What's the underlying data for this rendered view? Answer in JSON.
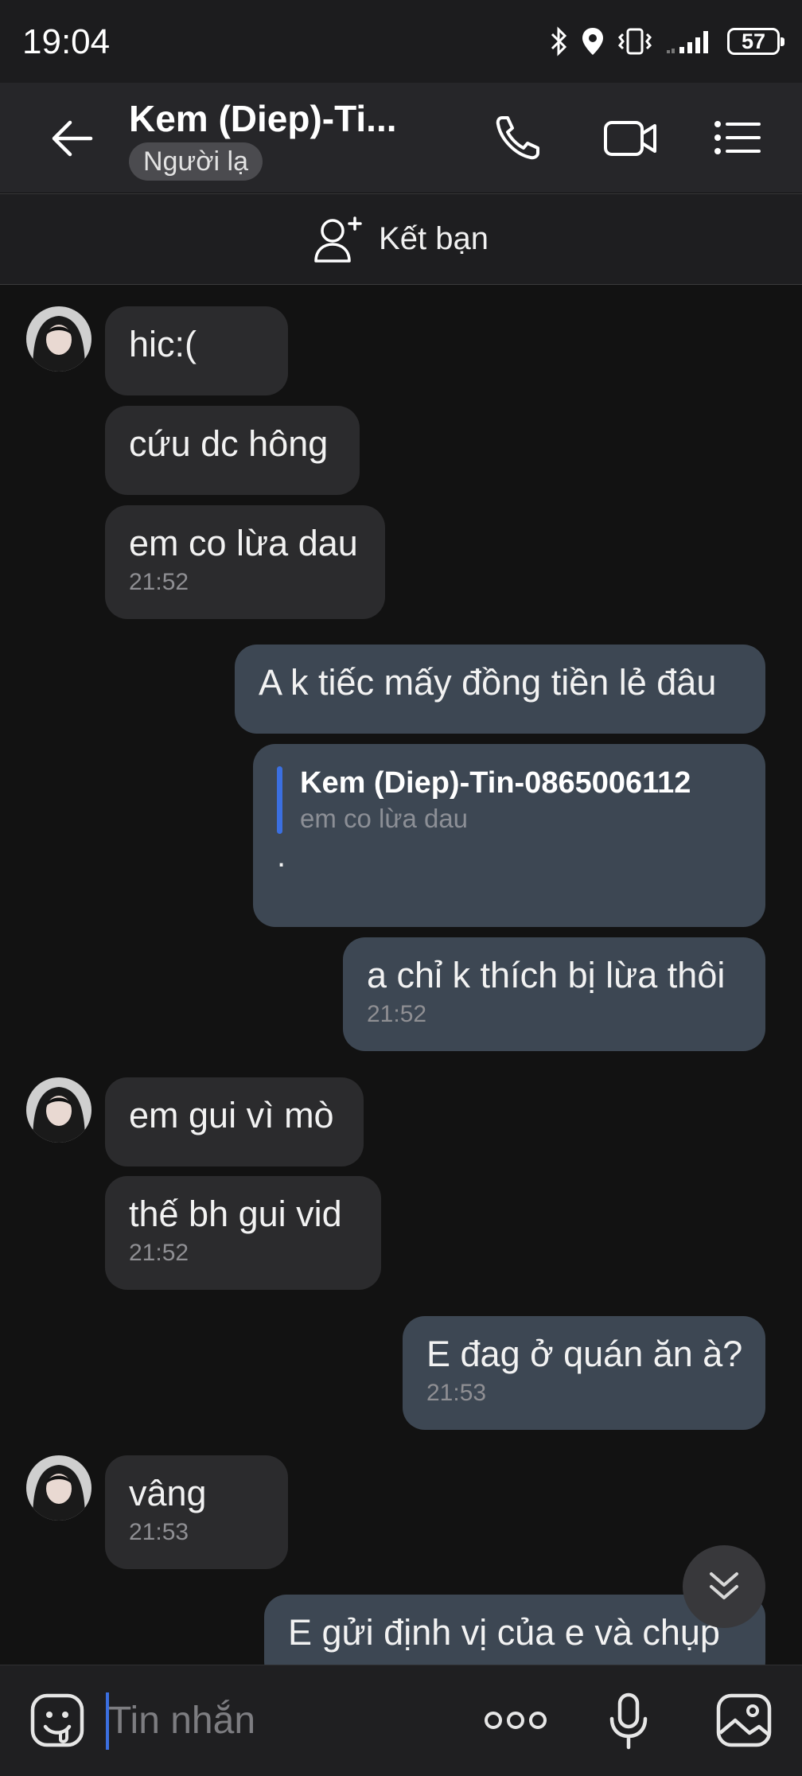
{
  "status_bar": {
    "time": "19:04",
    "battery": "57"
  },
  "header": {
    "contact_name": "Kem (Diep)-Ti...",
    "badge": "Người lạ"
  },
  "add_friend": {
    "label": "Kết bạn"
  },
  "messages": [
    {
      "side": "in",
      "text": "hic:("
    },
    {
      "side": "in",
      "text": "cứu dc hông"
    },
    {
      "side": "in",
      "text": "em co lừa dau",
      "time": "21:52"
    },
    {
      "side": "out",
      "text": "A k tiếc mấy đồng tiền lẻ đâu"
    },
    {
      "side": "out",
      "quote_name": "Kem (Diep)-Tin-0865006112",
      "quote_text": "em co lừa dau",
      "text": "."
    },
    {
      "side": "out",
      "text": "a chỉ k thích bị lừa thôi",
      "time": "21:52"
    },
    {
      "side": "in",
      "text": "em gui vì mò"
    },
    {
      "side": "in",
      "text": "thế bh gui vid",
      "time": "21:52"
    },
    {
      "side": "out",
      "text": "E đag ở quán ăn à?",
      "time": "21:53"
    },
    {
      "side": "in",
      "text": "vâng",
      "time": "21:53"
    },
    {
      "side": "out",
      "text": "E gửi định vị của e và chụp"
    }
  ],
  "input": {
    "placeholder": "Tin nhắn"
  },
  "icons": {
    "back": "arrow-left-icon",
    "call": "phone-icon",
    "video": "video-camera-icon",
    "menu": "list-menu-icon",
    "add_friend": "add-person-icon",
    "scroll": "double-chevron-down-icon",
    "sticker": "sticker-icon",
    "more": "more-dots-icon",
    "mic": "microphone-icon",
    "gallery": "image-gallery-icon"
  },
  "colors": {
    "background": "#121212",
    "incoming_bubble": "#2b2b2d",
    "outgoing_bubble": "#3d4753",
    "accent": "#3b6fe0"
  }
}
